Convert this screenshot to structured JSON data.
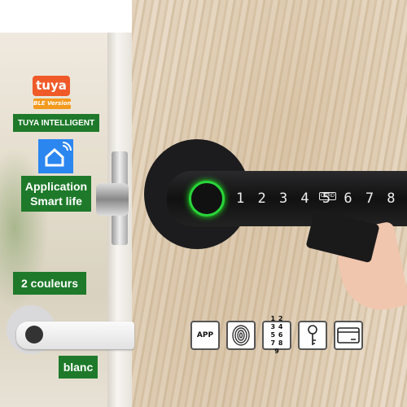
{
  "brand": {
    "logo": "tuya",
    "version": "BLE Version"
  },
  "badges": {
    "tuya": "TUYA INTELLIGENT",
    "app_line1": "Application",
    "app_line2": "Smart life",
    "colors": "2 couleurs",
    "variant": "blanc"
  },
  "keypad": {
    "digits": "1 2 3 4 5 6 7 8",
    "card_label": "CARD"
  },
  "features": [
    {
      "icon": "app-phone-icon",
      "label": "APP"
    },
    {
      "icon": "fingerprint-icon"
    },
    {
      "icon": "keypad-icon",
      "label": "1 2 3 4 5 6 7 8 9"
    },
    {
      "icon": "key-icon"
    },
    {
      "icon": "card-icon"
    }
  ],
  "colors": {
    "badge": "#1e7a2a",
    "tuya": "#f05a28",
    "smartlife": "#2b86f0",
    "fingerprint_ring": "#29d43a"
  }
}
